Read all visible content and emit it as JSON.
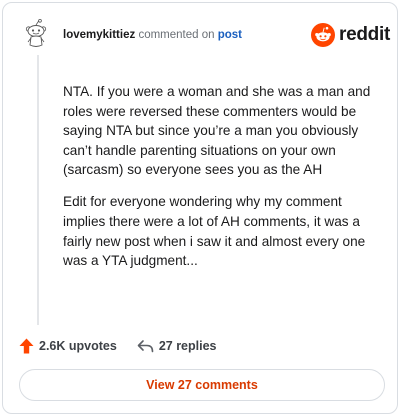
{
  "header": {
    "username": "lovemykittiez",
    "action_text": "commented on",
    "post_link": "post"
  },
  "brand": {
    "wordmark": "reddit",
    "accent": "#ff4500"
  },
  "comment": {
    "paragraphs": [
      "NTA. If you were a woman and she was a man and roles were reversed these commenters would be saying NTA but since you’re a man you obviously can’t handle parenting situations on your own (sarcasm) so everyone sees you as the AH",
      "Edit for everyone wondering why my comment implies there were a lot of AH comments, it was a fairly new post when i saw it and almost every one was a YTA judgment..."
    ]
  },
  "footer": {
    "upvotes": "2.6K upvotes",
    "replies": "27 replies",
    "upvote_icon": "upvote-arrow-icon",
    "reply_icon": "reply-arrow-icon"
  },
  "view_button": {
    "label": "View 27 comments",
    "color": "#d93a00"
  }
}
